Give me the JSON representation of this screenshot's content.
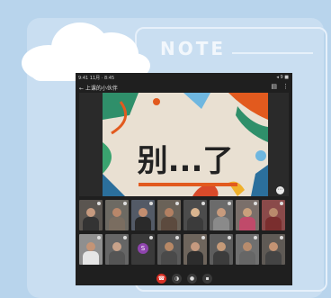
{
  "background": {
    "note_label": "NOTE"
  },
  "status_bar": {
    "time": "9:41 11月 · 8:45",
    "right": "◂ 9 ■"
  },
  "meeting": {
    "title": "← 上课的小伙伴"
  },
  "topbar_icons": {
    "layout_icon": "▤",
    "more_icon": "⋮"
  },
  "slide": {
    "text": "别...了"
  },
  "more_button": "⋯",
  "participants": [
    {
      "id": "p1",
      "kind": "video",
      "skin": "#c69a7f",
      "shirt": "#333333",
      "bg": "#5a5550"
    },
    {
      "id": "p2",
      "kind": "video",
      "skin": "#b9876a",
      "shirt": "#7a6d60",
      "bg": "#6d6a63"
    },
    {
      "id": "p3",
      "kind": "video",
      "skin": "#c28e70",
      "shirt": "#2a2a2a",
      "bg": "#535a66"
    },
    {
      "id": "p4",
      "kind": "video",
      "skin": "#b38062",
      "shirt": "#5c4a3e",
      "bg": "#6a6258"
    },
    {
      "id": "p5",
      "kind": "video",
      "skin": "#d9b48f",
      "shirt": "#3b3b3b",
      "bg": "#4c4c4c"
    },
    {
      "id": "p6",
      "kind": "video",
      "skin": "#c79b7d",
      "shirt": "#8a8a8a",
      "bg": "#6b6b6b"
    },
    {
      "id": "p7",
      "kind": "video",
      "skin": "#c9a07c",
      "shirt": "#c04a6a",
      "bg": "#7a6f6a"
    },
    {
      "id": "p8",
      "kind": "video",
      "skin": "#b98a6c",
      "shirt": "#7a2e2e",
      "bg": "#8a4a4a"
    },
    {
      "id": "p9",
      "kind": "video",
      "skin": "#c49476",
      "shirt": "#e6e6e6",
      "bg": "#8f8f8f"
    },
    {
      "id": "p10",
      "kind": "video",
      "skin": "#c8a28a",
      "shirt": "#555555",
      "bg": "#666666"
    },
    {
      "id": "p11",
      "kind": "avatar",
      "letter": "S",
      "color": "#8e44ad"
    },
    {
      "id": "p12",
      "kind": "video",
      "skin": "#b78866",
      "shirt": "#4a4a4a",
      "bg": "#5a5a5a"
    },
    {
      "id": "p13",
      "kind": "video",
      "skin": "#c69a7f",
      "shirt": "#2d2d2d",
      "bg": "#6e655c"
    },
    {
      "id": "p14",
      "kind": "video",
      "skin": "#c59a78",
      "shirt": "#3c3c3c",
      "bg": "#5d5d5d"
    },
    {
      "id": "p15",
      "kind": "video",
      "skin": "#b88c6d",
      "shirt": "#666666",
      "bg": "#707070"
    },
    {
      "id": "p16",
      "kind": "video",
      "skin": "#c49373",
      "shirt": "#444444",
      "bg": "#5f5a55"
    }
  ],
  "controls": [
    {
      "name": "end-call-button",
      "glyph": "☎",
      "end": true
    },
    {
      "name": "camera-button",
      "glyph": "◑",
      "end": false
    },
    {
      "name": "mic-button",
      "glyph": "●",
      "end": false
    },
    {
      "name": "present-button",
      "glyph": "▪",
      "end": false
    }
  ]
}
